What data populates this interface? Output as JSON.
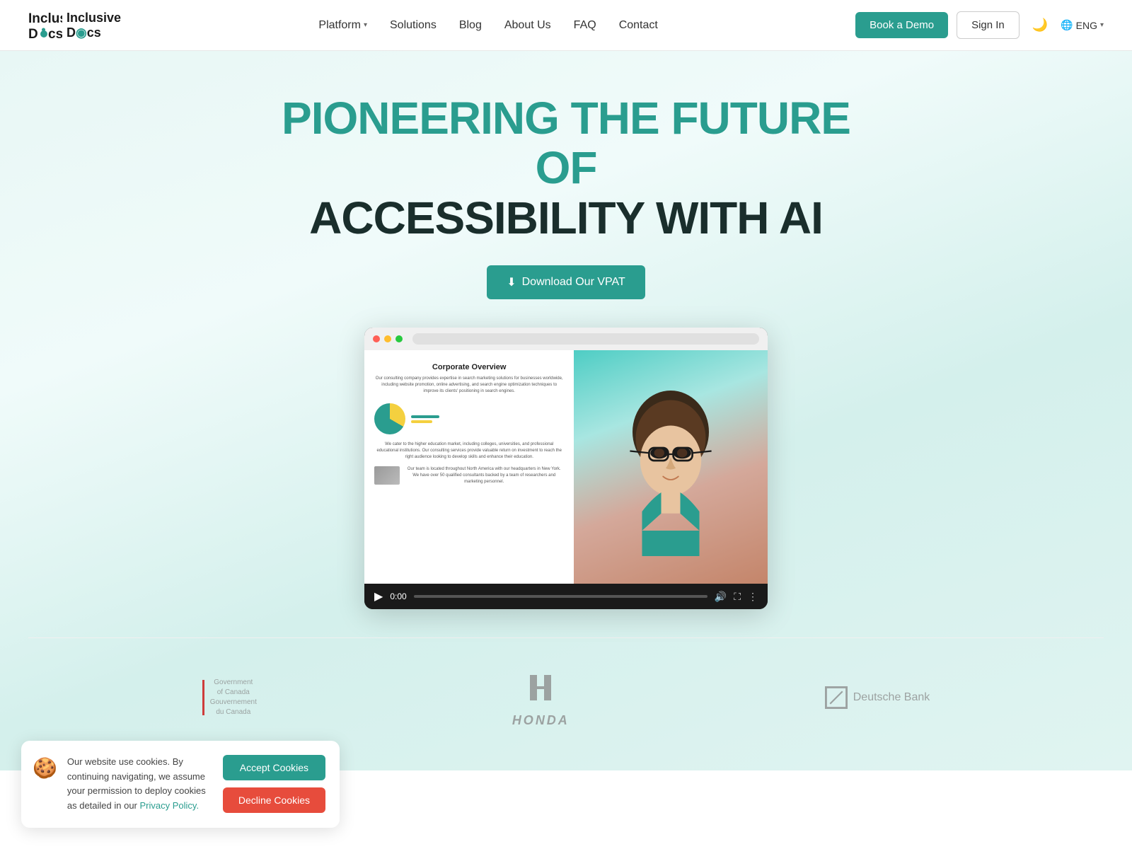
{
  "nav": {
    "logo_line1": "Inclusive",
    "logo_line2": "D⚿cs",
    "links": [
      {
        "label": "Platform",
        "has_dropdown": true
      },
      {
        "label": "Solutions",
        "has_dropdown": false
      },
      {
        "label": "Blog",
        "has_dropdown": false
      },
      {
        "label": "About Us",
        "has_dropdown": false
      },
      {
        "label": "FAQ",
        "has_dropdown": false
      },
      {
        "label": "Contact",
        "has_dropdown": false
      }
    ],
    "book_demo": "Book a Demo",
    "sign_in": "Sign In",
    "lang": "ENG"
  },
  "hero": {
    "headline_line1": "PIONEERING THE FUTURE OF",
    "headline_line2": "ACCESSIBILITY WITH AI",
    "vpat_button": "Download Our VPAT",
    "video_time": "0:00"
  },
  "cookie": {
    "message": "Our website use cookies. By continuing navigating, we assume your permission to deploy cookies as detailed in our ",
    "policy_link": "Privacy Policy.",
    "accept": "Accept Cookies",
    "decline": "Decline Cookies"
  },
  "logos": {
    "canada_gov_line1": "Government",
    "canada_gov_line2": "of Canada",
    "canada_gov_line3": "Gouvernement",
    "canada_gov_line4": "du Canada",
    "honda": "HONDA",
    "deutsche": "Deutsche Bank"
  }
}
